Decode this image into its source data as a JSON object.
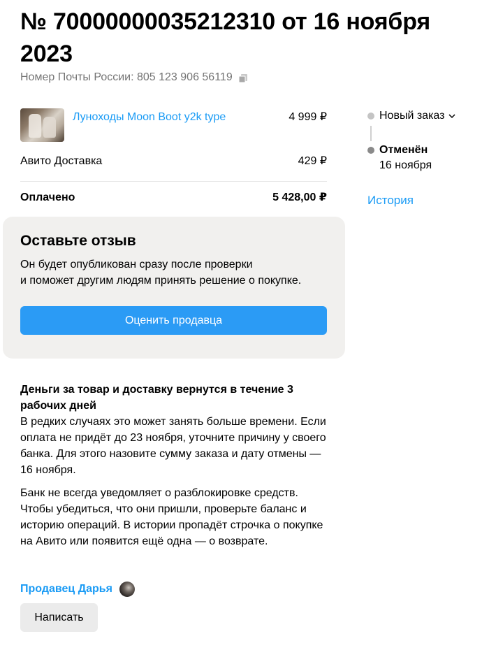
{
  "order": {
    "title": "№ 70000000035212310 от 16 ноября 2023",
    "tracking_text": "Номер Почты России: 805 123 906 56119"
  },
  "items": [
    {
      "name": "Луноходы Moon Boot y2k type",
      "price": "4 999 ₽"
    }
  ],
  "delivery": {
    "label": "Авито Доставка",
    "price": "429 ₽"
  },
  "paid": {
    "label": "Оплачено",
    "amount": "5 428,00 ₽"
  },
  "status": {
    "current_label": "Новый заказ",
    "cancel_label": "Отменён",
    "cancel_date": "16 ноября",
    "history_link": "История",
    "colors": {
      "current_dot": "#c4c4c4",
      "cancel_dot": "#8a8a8a"
    }
  },
  "review": {
    "title": "Оставьте отзыв",
    "text_line1": "Он будет опубликован сразу после проверки",
    "text_line2": "и поможет другим людям принять решение о покупке.",
    "button": "Оценить продавца"
  },
  "refund": {
    "title": "Деньги за товар и доставку вернутся в течение 3 рабочих дней",
    "paragraph1": "В редких случаях это может занять больше времени. Если оплата не придёт до 23 ноября, уточните причину у своего банка. Для этого назовите сумму заказа и дату отмены — 16 ноября.",
    "paragraph2": "Банк не всегда уведомляет о разблокировке средств. Чтобы убедиться, что они пришли, проверьте баланс и историю операций. В истории пропадёт строчка о покупке на Авито или появится ещё одна — о возврате."
  },
  "seller": {
    "label": "Продавец Дарья",
    "write_button": "Написать"
  },
  "colors": {
    "link": "#1a9bf5",
    "primary_button": "#2b9bf5",
    "card_bg": "#f1f0ee"
  },
  "icons": {
    "copy": "copy-icon",
    "chevron": "chevron-down-icon"
  }
}
